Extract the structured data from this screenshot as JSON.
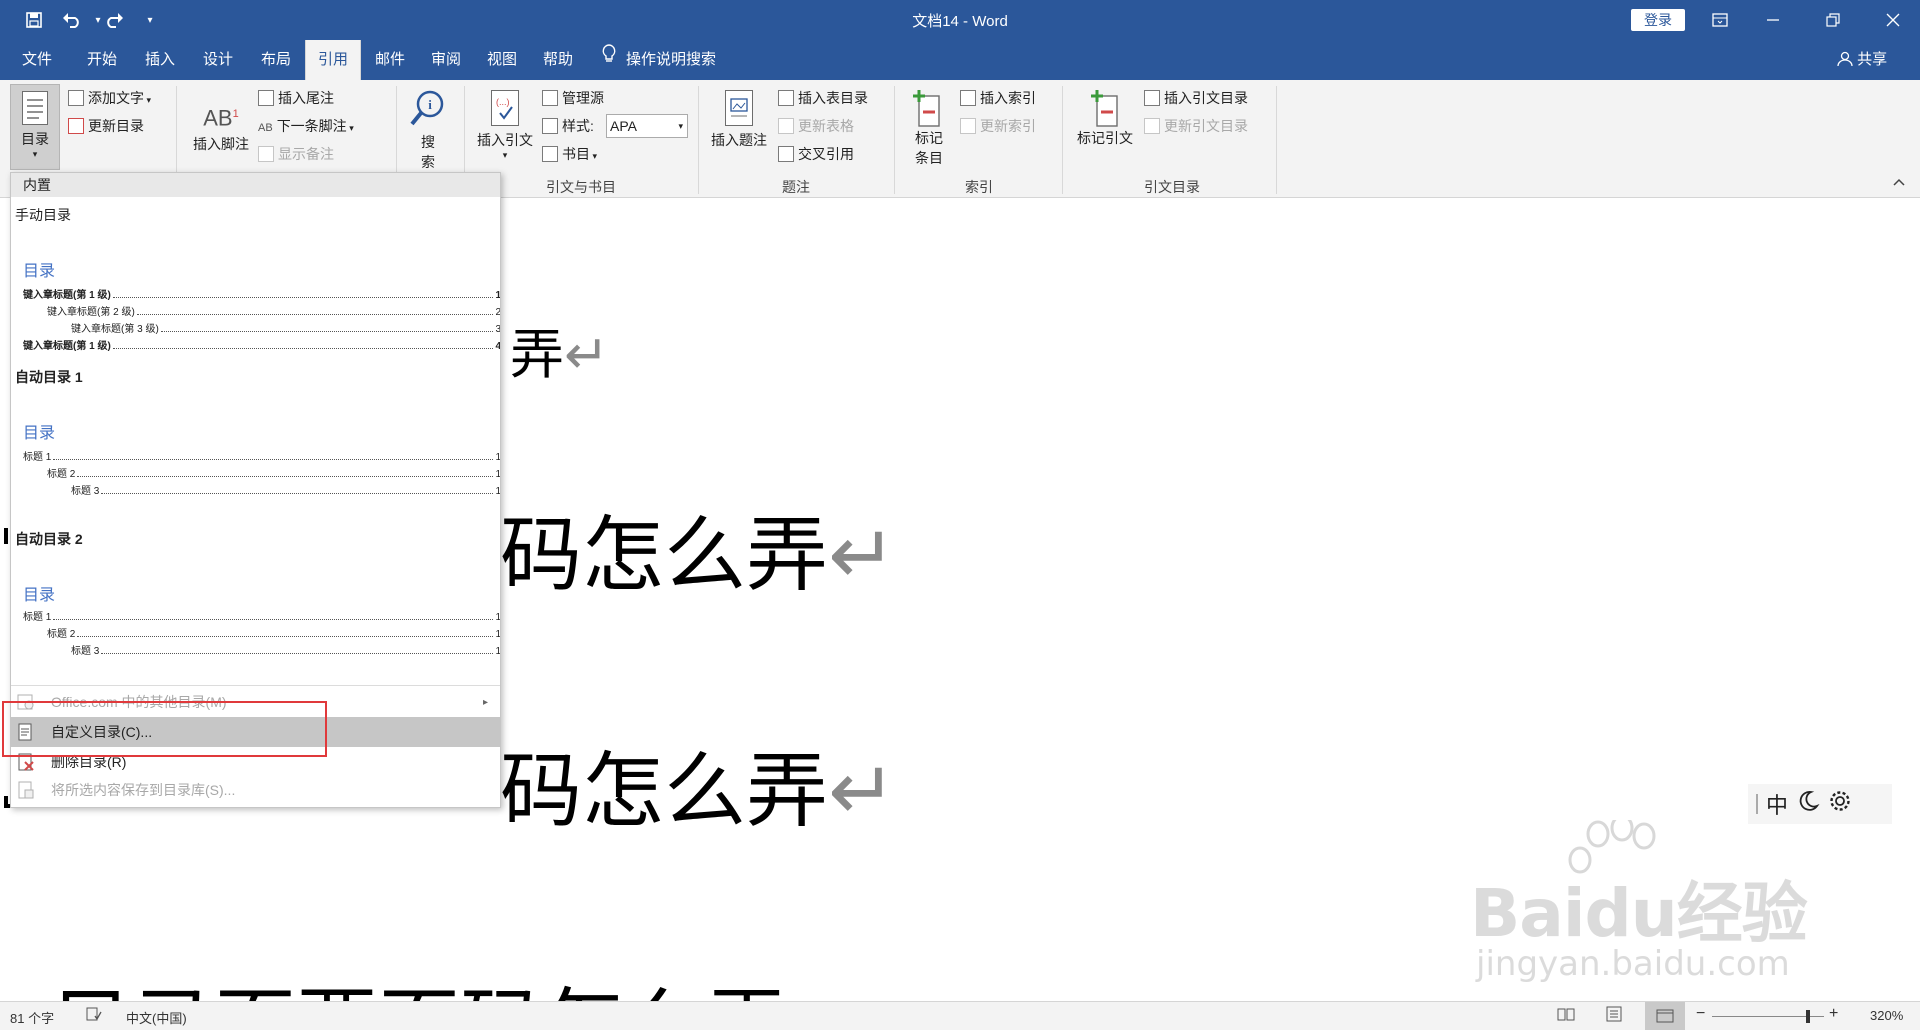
{
  "titlebar": {
    "title": "文档14 - Word",
    "login": "登录"
  },
  "tabs": [
    {
      "label": "文件"
    },
    {
      "label": "开始"
    },
    {
      "label": "插入"
    },
    {
      "label": "设计"
    },
    {
      "label": "布局"
    },
    {
      "label": "引用"
    },
    {
      "label": "邮件"
    },
    {
      "label": "审阅"
    },
    {
      "label": "视图"
    },
    {
      "label": "帮助"
    }
  ],
  "active_tab": "引用",
  "tellme": "操作说明搜索",
  "share": "共享",
  "ribbon": {
    "toc": {
      "button": "目录",
      "add_text": "添加文字",
      "update": "更新目录"
    },
    "footnotes": {
      "insert_footnote": "插入脚注",
      "insert_endnote": "插入尾注",
      "next_footnote": "下一条脚注",
      "show_notes": "显示备注"
    },
    "research": {
      "search": "搜",
      "search2": "索"
    },
    "citations": {
      "insert_citation": "插入引文",
      "manage_sources": "管理源",
      "style_label": "样式:",
      "style_value": "APA",
      "bibliography": "书目",
      "group": "引文与书目"
    },
    "captions": {
      "insert_caption": "插入题注",
      "insert_tof": "插入表目录",
      "update_table": "更新表格",
      "cross_ref": "交叉引用",
      "group": "题注"
    },
    "index": {
      "mark_entry_1": "标记",
      "mark_entry_2": "条目",
      "insert_index": "插入索引",
      "update_index": "更新索引",
      "group": "索引"
    },
    "toa": {
      "mark_citation": "标记引文",
      "insert_toa": "插入引文目录",
      "update_toa": "更新引文目录",
      "group": "引文目录"
    }
  },
  "document": {
    "line1": "弄",
    "line2": "码怎么弄",
    "line3": "码怎么弄",
    "line4": "目录页要页码怎么弄"
  },
  "toc_menu": {
    "header": "内置",
    "gallery": [
      {
        "title": "手动目录",
        "heading": "目录",
        "rows": [
          {
            "text": "键入章标题(第 1 级)",
            "num": "1",
            "bold": true,
            "level": 1
          },
          {
            "text": "键入章标题(第 2 级)",
            "num": "2",
            "bold": false,
            "level": 2
          },
          {
            "text": "键入章标题(第 3 级)",
            "num": "3",
            "bold": false,
            "level": 3
          },
          {
            "text": "键入章标题(第 1 级)",
            "num": "4",
            "bold": true,
            "level": 1
          }
        ]
      },
      {
        "title": "自动目录 1",
        "heading": "目录",
        "rows": [
          {
            "text": "标题 1",
            "num": "1",
            "level": 1
          },
          {
            "text": "标题 2",
            "num": "1",
            "level": 2
          },
          {
            "text": "标题 3",
            "num": "1",
            "level": 3
          }
        ]
      },
      {
        "title": "自动目录 2",
        "heading": "目录",
        "rows": [
          {
            "text": "标题 1",
            "num": "1",
            "level": 1
          },
          {
            "text": "标题 2",
            "num": "1",
            "level": 2
          },
          {
            "text": "标题 3",
            "num": "1",
            "level": 3
          }
        ]
      }
    ],
    "items": {
      "more": "Office.com 中的其他目录(M)",
      "custom": "自定义目录(C)...",
      "remove": "删除目录(R)",
      "save": "将所选内容保存到目录库(S)..."
    }
  },
  "ime": {
    "mode": "中"
  },
  "watermark": {
    "brand": "Baidu经验",
    "url": "jingyan.baidu.com"
  },
  "statusbar": {
    "words": "81 个字",
    "language": "中文(中国)",
    "zoom": "320%"
  },
  "colors": {
    "accent": "#2b579a",
    "highlight_box": "#e0393b",
    "toc_heading": "#4472c4"
  }
}
